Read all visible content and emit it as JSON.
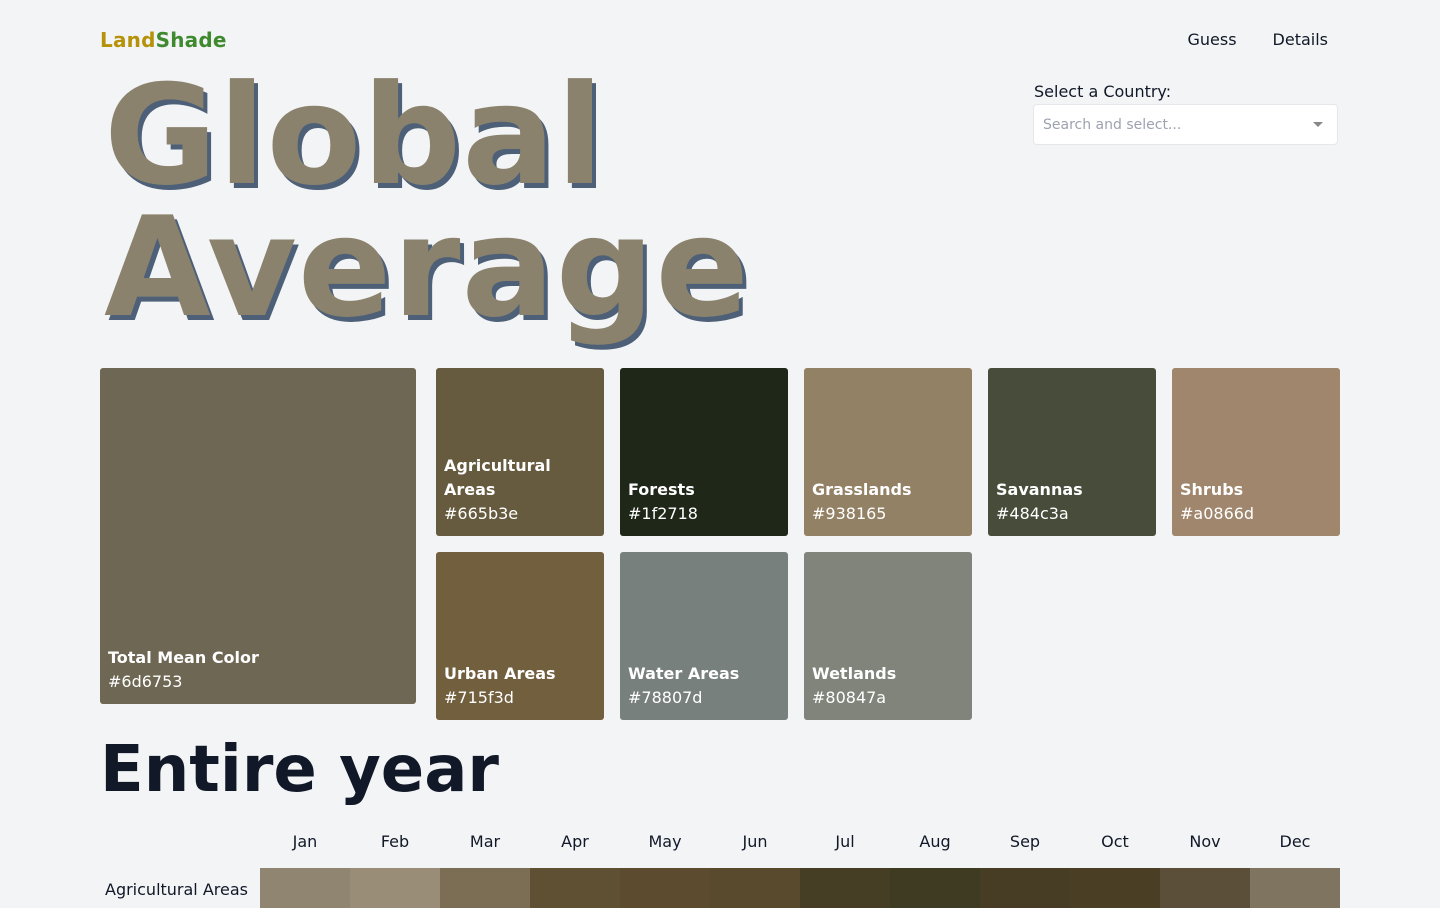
{
  "header": {
    "logo": "LandShade",
    "nav": [
      "Guess",
      "Details"
    ]
  },
  "country": {
    "label": "Select a Country:",
    "placeholder": "Search and select..."
  },
  "hero": {
    "line1": "Global",
    "line2": "Average"
  },
  "total": {
    "name": "Total Mean Color",
    "hex": "#6d6753"
  },
  "swatches": [
    {
      "name": "Agricultural Areas",
      "hex": "#665b3e"
    },
    {
      "name": "Forests",
      "hex": "#1f2718"
    },
    {
      "name": "Grasslands",
      "hex": "#938165"
    },
    {
      "name": "Savannas",
      "hex": "#484c3a"
    },
    {
      "name": "Shrubs",
      "hex": "#a0866d"
    },
    {
      "name": "Urban Areas",
      "hex": "#715f3d"
    },
    {
      "name": "Water Areas",
      "hex": "#78807d"
    },
    {
      "name": "Wetlands",
      "hex": "#80847a"
    }
  ],
  "year": {
    "title": "Entire year",
    "months": [
      "Jan",
      "Feb",
      "Mar",
      "Apr",
      "May",
      "Jun",
      "Jul",
      "Aug",
      "Sep",
      "Oct",
      "Nov",
      "Dec"
    ],
    "rows": [
      {
        "label": "Agricultural Areas",
        "colors": [
          "#908570",
          "#9a8d77",
          "#7c6e54",
          "#5f4f33",
          "#5c4b2e",
          "#594a2d",
          "#463e24",
          "#3f3b22",
          "#463d24",
          "#4a3e25",
          "#5c4f3a",
          "#7f7460"
        ]
      }
    ]
  }
}
